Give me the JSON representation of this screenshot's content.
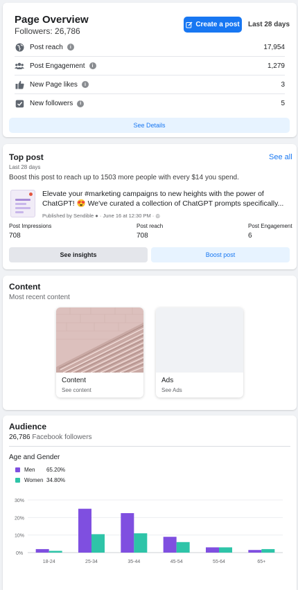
{
  "overview": {
    "title": "Page Overview",
    "followers": "Followers: 26,786",
    "create_label": "Create a post",
    "period": "Last 28 days",
    "metrics": [
      {
        "label": "Post reach",
        "value": "17,954",
        "icon": "globe-icon"
      },
      {
        "label": "Post Engagement",
        "value": "1,279",
        "icon": "people-icon"
      },
      {
        "label": "New Page likes",
        "value": "3",
        "icon": "thumbs-up-icon"
      },
      {
        "label": "New followers",
        "value": "5",
        "icon": "check-box-icon"
      }
    ],
    "details_label": "See Details"
  },
  "top_post": {
    "title": "Top post",
    "see_all": "See all",
    "period": "Last 28 days",
    "boost_text": "Boost this post to reach up to 1503 more people with every $14 you spend.",
    "post_text_1": "Elevate your #marketing campaigns to new heights with the power of",
    "post_text_2": "ChatGPT! 😍 We've curated a collection of ChatGPT prompts specifically...",
    "meta": "Published by Sendible ● · June 16 at 12:30 PM · ◎",
    "stats": [
      {
        "label": "Post Impressions",
        "value": "708"
      },
      {
        "label": "Post reach",
        "value": "708"
      },
      {
        "label": "Post Engagement",
        "value": "6"
      }
    ],
    "insights_label": "See insights",
    "boost_label": "Boost post"
  },
  "content": {
    "title": "Content",
    "subtitle": "Most recent content",
    "tiles": [
      {
        "title": "Content",
        "sub": "See content"
      },
      {
        "title": "Ads",
        "sub": "See Ads"
      }
    ]
  },
  "audience": {
    "title": "Audience",
    "followers_count": "26,786",
    "followers_label": "Facebook followers",
    "age_gender": "Age and Gender",
    "legend": [
      {
        "name": "Men",
        "pct": "65.20%",
        "color": "#7f4fe0"
      },
      {
        "name": "Women",
        "pct": "34.80%",
        "color": "#2ec4a8"
      }
    ]
  },
  "chart_data": {
    "type": "bar",
    "categories": [
      "18-24",
      "25-34",
      "35-44",
      "45-54",
      "55-64",
      "65+"
    ],
    "series": [
      {
        "name": "Men",
        "values": [
          2,
          25,
          22.5,
          9,
          3,
          1.5
        ],
        "color": "#7f4fe0"
      },
      {
        "name": "Women",
        "values": [
          1,
          10.5,
          11,
          6,
          3,
          2
        ],
        "color": "#2ec4a8"
      }
    ],
    "y_ticks": [
      "0%",
      "10%",
      "20%",
      "30%"
    ],
    "ylim": [
      0,
      30
    ],
    "grid": true
  }
}
